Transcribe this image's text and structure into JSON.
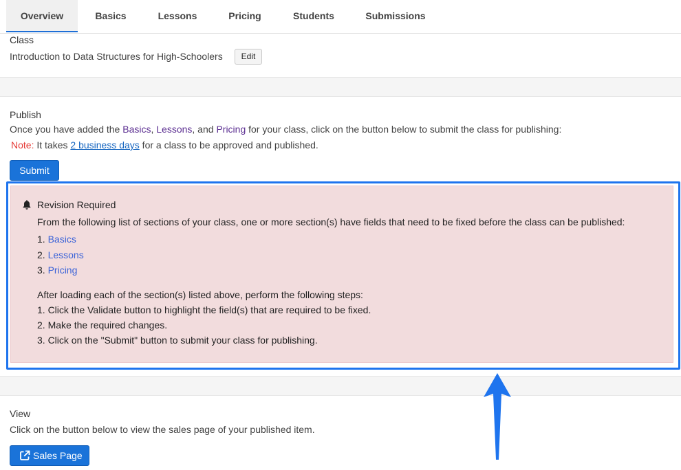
{
  "tabs": [
    {
      "label": "Overview",
      "active": true
    },
    {
      "label": "Basics"
    },
    {
      "label": "Lessons"
    },
    {
      "label": "Pricing"
    },
    {
      "label": "Students"
    },
    {
      "label": "Submissions"
    }
  ],
  "class_section": {
    "heading": "Class",
    "name": "Introduction to Data Structures for High-Schoolers",
    "edit_label": "Edit"
  },
  "publish": {
    "heading": "Publish",
    "instr_pre": "Once you have added the ",
    "basics": "Basics",
    "comma": ", ",
    "lessons": "Lessons",
    "and": ", and ",
    "pricing": "Pricing",
    "instr_post": " for your class, click on the button below to submit the class for publishing:",
    "note_label": "Note:",
    "note_pre": " It takes ",
    "note_link": "2 business days",
    "note_post": " for a class to be approved and published.",
    "submit_label": "Submit"
  },
  "alert": {
    "title": "Revision Required",
    "intro": "From the following list of sections of your class, one or more section(s) have fields that need to be fixed before the class can be published:",
    "sections": [
      {
        "num": "1.",
        "label": "Basics"
      },
      {
        "num": "2.",
        "label": "Lessons"
      },
      {
        "num": "3.",
        "label": "Pricing"
      }
    ],
    "steps_intro": "After loading each of the section(s) listed above, perform the following steps:",
    "steps": [
      "1. Click the Validate button to highlight the field(s) that are required to be fixed.",
      "2. Make the required changes.",
      "3. Click on the \"Submit\" button to submit your class for publishing."
    ]
  },
  "view": {
    "heading": "View",
    "description": "Click on the button below to view the sales page of your published item.",
    "sales_label": "Sales Page"
  },
  "colors": {
    "primary": "#1a73d9",
    "alert_bg": "#f2dcdd",
    "highlight": "#1e74ee",
    "note_red": "#e53935"
  },
  "icons": [
    "bell-icon",
    "external-link-icon",
    "pointer-arrow-icon"
  ]
}
